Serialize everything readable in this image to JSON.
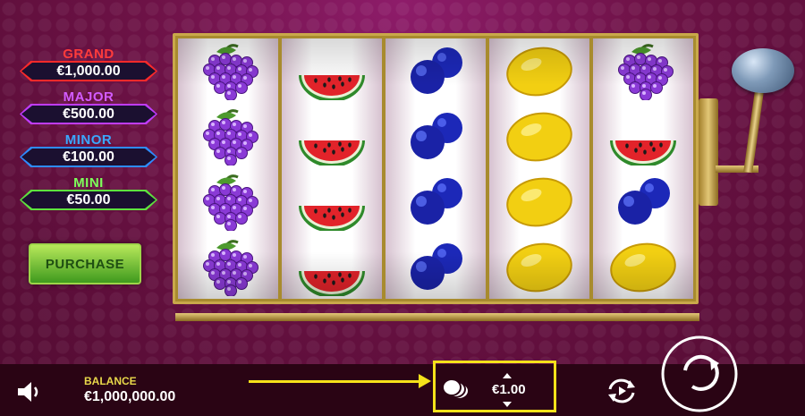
{
  "jackpots": [
    {
      "name": "GRAND",
      "value": "€1,000.00",
      "color": "#ff2a2a"
    },
    {
      "name": "MAJOR",
      "value": "€500.00",
      "color": "#c03cff"
    },
    {
      "name": "MINOR",
      "value": "€100.00",
      "color": "#2e8cff"
    },
    {
      "name": "MINI",
      "value": "€50.00",
      "color": "#5ee23e"
    }
  ],
  "purchase_label": "PURCHASE",
  "reels": [
    [
      "grapes",
      "grapes",
      "grapes",
      "grapes"
    ],
    [
      "watermelon",
      "watermelon",
      "watermelon",
      "watermelon"
    ],
    [
      "plums",
      "plums",
      "plums",
      "plums"
    ],
    [
      "lemon",
      "lemon",
      "lemon",
      "lemon"
    ],
    [
      "grapes",
      "watermelon",
      "plums",
      "lemon"
    ]
  ],
  "footer": {
    "balance_label": "BALANCE",
    "balance_value": "€1,000,000.00",
    "bet_value": "€1.00"
  },
  "icons": {
    "sound": "speaker-icon",
    "coins": "coins-icon",
    "autoplay": "autoplay-icon",
    "spin": "spin-icon"
  },
  "highlight_color": "#f5e21a"
}
